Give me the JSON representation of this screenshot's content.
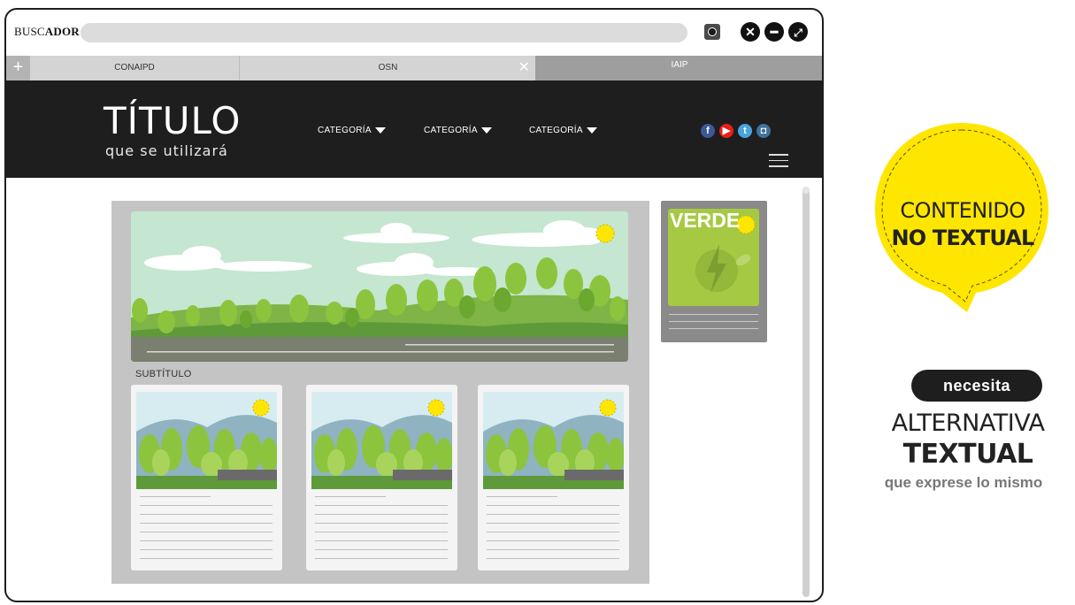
{
  "browser": {
    "search_label_prefix": "BUSC",
    "search_label_bold": "ADOR",
    "window_buttons": {
      "close_icon": "x-circle-icon",
      "minimize_icon": "minus-circle-icon",
      "maximize_icon": "expand-circle-icon"
    },
    "tabs": [
      {
        "label": "CONAIPD"
      },
      {
        "label": "OSN"
      },
      {
        "label": "IAIP"
      }
    ]
  },
  "site": {
    "title": "TÍTULO",
    "subtitle": "que se utilizará",
    "nav": [
      {
        "label": "CATEGORÍA"
      },
      {
        "label": "CATEGORÍA"
      },
      {
        "label": "CATEGORÍA"
      }
    ],
    "social": [
      "facebook-icon",
      "youtube-icon",
      "twitter-icon",
      "instagram-icon"
    ]
  },
  "content": {
    "section_subtitle": "SUBTÍTULO",
    "sidebar_ad_title": "VERDE"
  },
  "callout": {
    "line1": "CONTENIDO",
    "line2": "NO TEXTUAL",
    "pill": "necesita",
    "line3": "ALTERNATIVA",
    "line4": "TEXTUAL",
    "line5": "que exprese lo mismo",
    "accent_color": "#ffe600"
  }
}
